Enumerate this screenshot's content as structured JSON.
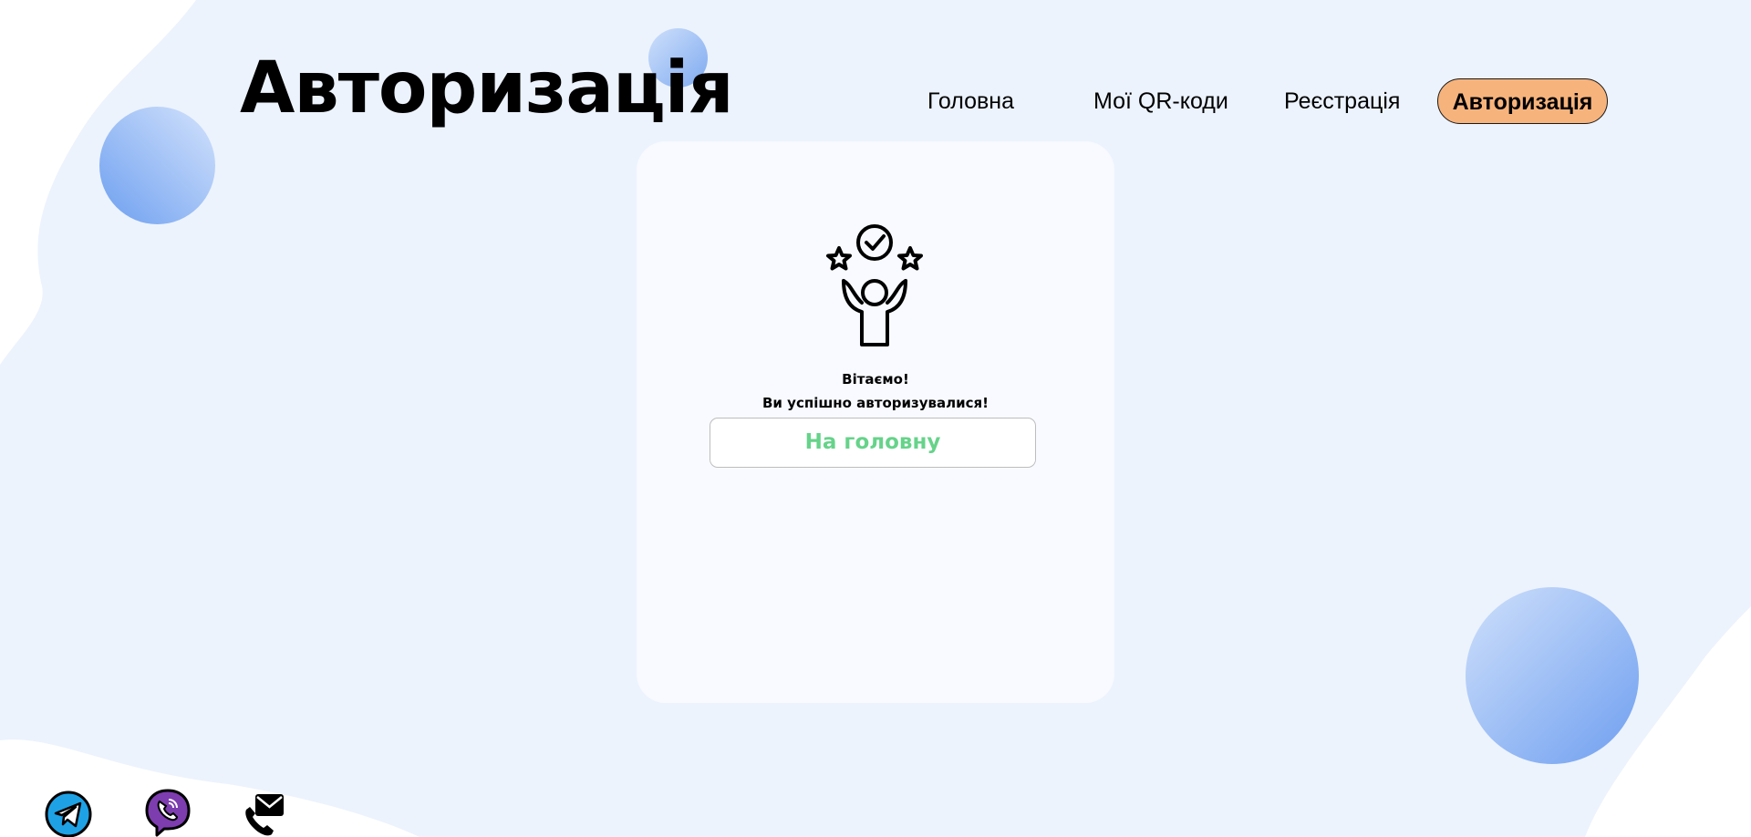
{
  "header": {
    "title": "Авторизація"
  },
  "nav": {
    "items": [
      {
        "label": "Головна",
        "active": false
      },
      {
        "label": "Мої QR-коди",
        "active": false
      },
      {
        "label": "Реєстрація",
        "active": false
      },
      {
        "label": "Авторизація",
        "active": true
      }
    ]
  },
  "card": {
    "icon": "success-person-icon",
    "welcome_line1": "Вітаємо!",
    "welcome_line2": "Ви успішно авторизувалися!",
    "home_button": "На головну"
  },
  "social": {
    "icons": [
      "telegram-icon",
      "viber-icon",
      "mail-phone-icon"
    ]
  },
  "colors": {
    "background": "#ecf3fd",
    "accent_nav": "#f7b37c",
    "button_text": "#66d38a",
    "card_bg": "#f8faff"
  }
}
